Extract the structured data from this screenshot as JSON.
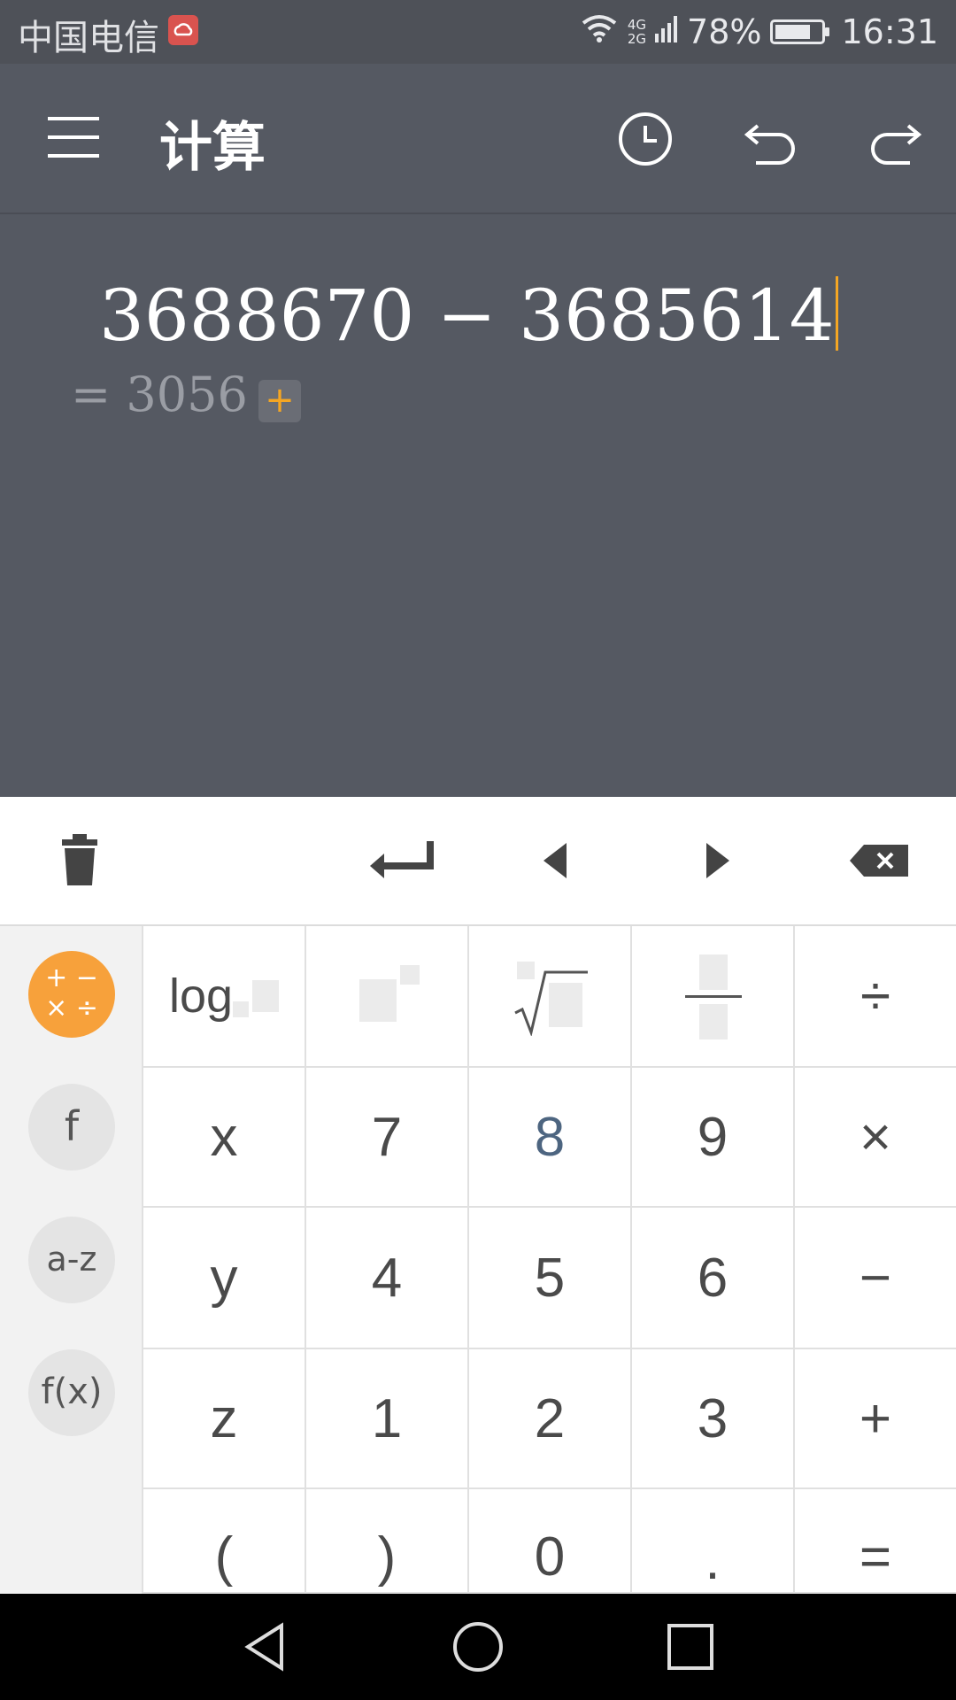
{
  "status_bar": {
    "carrier": "中国电信",
    "network_top": "4G",
    "network_bottom": "2G",
    "battery": "78%",
    "battery_level": 0.78,
    "time": "16:31"
  },
  "app_bar": {
    "title": "计算",
    "icons": [
      "menu-icon",
      "history-icon",
      "undo-icon",
      "redo-icon"
    ]
  },
  "expression": {
    "input": "3688670 − 3685614",
    "result": "= 3056",
    "add_label": "+"
  },
  "toolbar": {
    "icons": [
      "trash-icon",
      "enter-icon",
      "cursor-left-icon",
      "cursor-right-icon",
      "backspace-icon"
    ]
  },
  "side_panel": {
    "basic_ops_label": "+ −\n× ÷",
    "function_label": "f",
    "letters_label": "a-z",
    "fx_label": "f(x)"
  },
  "keys": {
    "log": "log",
    "divide": "÷",
    "x": "x",
    "seven": "7",
    "eight": "8",
    "nine": "9",
    "multiply": "×",
    "y": "y",
    "four": "4",
    "five": "5",
    "six": "6",
    "minus": "−",
    "z": "z",
    "one": "1",
    "two": "2",
    "three": "3",
    "plus": "+",
    "lparen": "(",
    "rparen": ")",
    "zero": "0",
    "dot": ".",
    "equals": "="
  },
  "colors": {
    "background": "#555962",
    "accent": "#f5a623",
    "active_side_button": "#f7a13b"
  }
}
